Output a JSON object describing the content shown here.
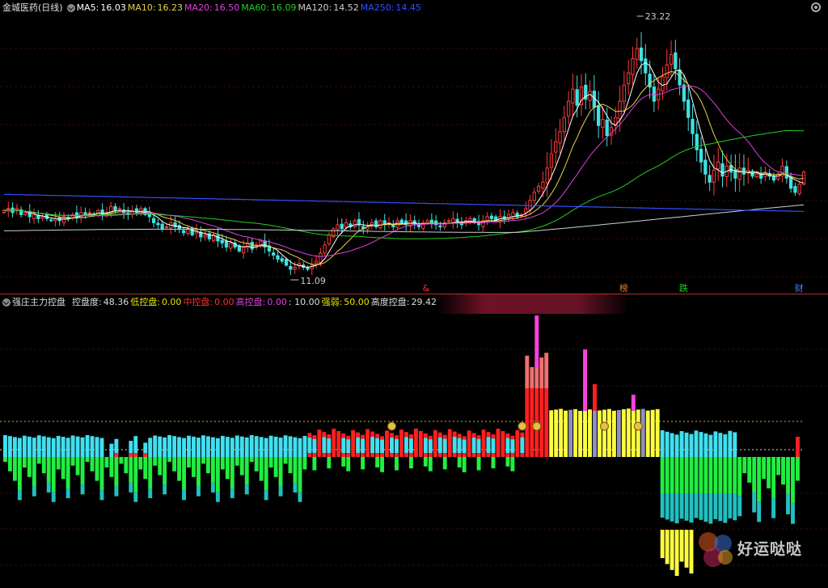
{
  "main_header": {
    "stock_name": "金城医药(日线)",
    "ma": [
      {
        "label": "MA5:",
        "value": "16.03",
        "color": "#ffffff"
      },
      {
        "label": "MA10:",
        "value": "16.23",
        "color": "#e6d24a"
      },
      {
        "label": "MA20:",
        "value": "16.50",
        "color": "#e040e0"
      },
      {
        "label": "MA60:",
        "value": "16.09",
        "color": "#20d020"
      },
      {
        "label": "MA120:",
        "value": "14.52",
        "color": "#d0d0d0"
      },
      {
        "label": "MA250:",
        "value": "14.45",
        "color": "#3050ff"
      }
    ]
  },
  "indicator_header": {
    "name": "强庄主力控盘",
    "items": [
      {
        "label": "控盘度:",
        "value": "48.36",
        "color": "#dddddd"
      },
      {
        "label": "低控盘:",
        "value": "0.00",
        "color": "#e6e600"
      },
      {
        "label": "中控盘:",
        "value": "0.00",
        "color": "#ff3030"
      },
      {
        "label": "高控盘:",
        "value": "0.00",
        "color": "#e040e0"
      },
      {
        "label": "",
        "value": ": 10.00",
        "color": "#dddddd"
      },
      {
        "label": "强弱:",
        "value": "50.00",
        "color": "#e6e600"
      },
      {
        "label": "高度控盘:",
        "value": "29.42",
        "color": "#dddddd"
      }
    ]
  },
  "watermark": "好运哒哒",
  "chart_data": [
    {
      "type": "candlestick",
      "title": "金城医药(日线)",
      "ylim": [
        10.5,
        24
      ],
      "high_label": "23.22",
      "low_label": "11.09",
      "event_markers": [
        {
          "index": 99,
          "text": "&",
          "color": "#ff3030"
        },
        {
          "index": 145,
          "text": "榜",
          "color": "#e08030"
        },
        {
          "index": 159,
          "text": "跌",
          "color": "#20d020"
        },
        {
          "index": 186,
          "text": "财",
          "color": "#4080ff"
        }
      ],
      "ohlc_closes": [
        14.4,
        14.5,
        14.3,
        14.5,
        14.2,
        14.3,
        14.1,
        14.2,
        14.0,
        14.1,
        14.0,
        13.9,
        14.0,
        13.9,
        14.1,
        14.0,
        14.2,
        14.1,
        14.3,
        14.2,
        14.3,
        14.2,
        14.4,
        14.2,
        14.3,
        14.6,
        14.4,
        14.5,
        14.3,
        14.2,
        14.4,
        14.3,
        14.5,
        14.2,
        14.1,
        13.8,
        13.7,
        13.5,
        13.6,
        13.8,
        13.6,
        13.5,
        13.3,
        13.5,
        13.2,
        13.4,
        13.1,
        13.2,
        13.0,
        13.2,
        12.9,
        12.8,
        12.6,
        12.8,
        12.6,
        12.4,
        12.6,
        12.8,
        12.5,
        12.7,
        12.9,
        12.6,
        12.4,
        12.2,
        12.0,
        11.9,
        11.7,
        11.5,
        11.6,
        11.8,
        11.6,
        11.5,
        11.7,
        11.9,
        12.3,
        12.7,
        13.2,
        13.5,
        13.7,
        13.5,
        13.8,
        13.6,
        13.9,
        13.7,
        13.5,
        13.6,
        13.8,
        13.6,
        13.9,
        13.7,
        13.8,
        13.6,
        13.9,
        13.8,
        13.7,
        13.9,
        13.7,
        13.6,
        13.8,
        13.9,
        13.8,
        13.7,
        13.6,
        13.8,
        13.9,
        14.0,
        13.8,
        13.7,
        13.9,
        14.0,
        13.8,
        13.7,
        13.9,
        14.1,
        14.0,
        13.9,
        14.1,
        14.0,
        14.2,
        14.3,
        14.1,
        14.2,
        14.5,
        14.9,
        15.3,
        15.6,
        15.8,
        16.5,
        17.2,
        17.8,
        18.3,
        19.0,
        19.8,
        20.4,
        19.6,
        20.5,
        19.9,
        20.3,
        19.5,
        18.6,
        18.9,
        18.1,
        18.5,
        19.0,
        19.8,
        20.6,
        21.2,
        21.9,
        22.4,
        21.8,
        21.2,
        20.5,
        19.8,
        20.4,
        21.0,
        21.6,
        22.1,
        21.4,
        20.6,
        19.8,
        19.0,
        18.2,
        17.4,
        16.8,
        16.2,
        15.8,
        16.4,
        16.8,
        16.1,
        16.6,
        16.3,
        16.0,
        16.5,
        16.2,
        16.4,
        16.1,
        16.2,
        16.0,
        16.3,
        16.1,
        15.9,
        16.2,
        16.6,
        16.0,
        15.5,
        15.3,
        15.7,
        16.3
      ]
    },
    {
      "type": "bar",
      "title": "强庄主力控盘",
      "reference_levels": {
        "dotted_yellow": 40,
        "dotted_white": 10
      },
      "series_names": [
        "低控盘",
        "中控盘",
        "高控盘",
        "强弱",
        "高度控盘"
      ]
    }
  ]
}
